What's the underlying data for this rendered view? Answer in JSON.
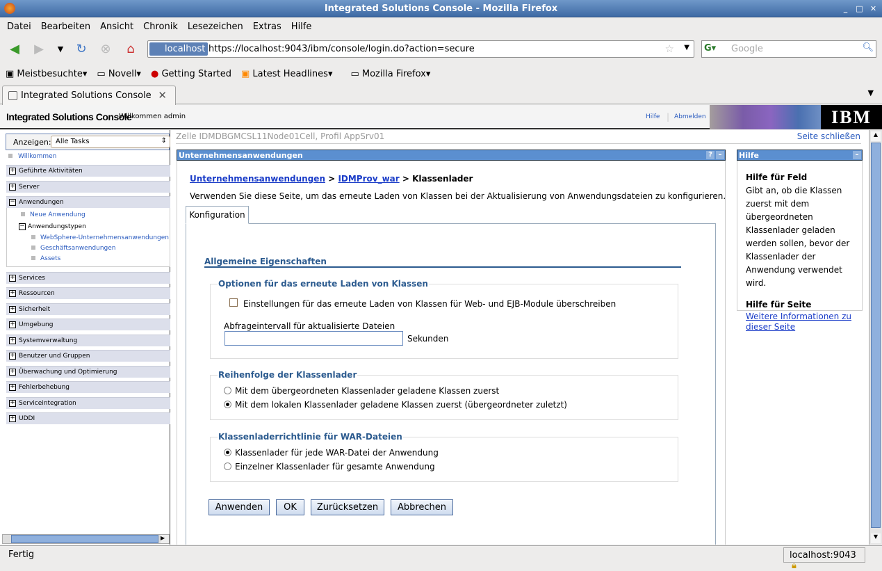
{
  "window": {
    "title": "Integrated Solutions Console - Mozilla Firefox"
  },
  "menu": [
    "Datei",
    "Bearbeiten",
    "Ansicht",
    "Chronik",
    "Lesezeichen",
    "Extras",
    "Hilfe"
  ],
  "nav": {
    "site": "localhost",
    "url": "https://localhost:9043/ibm/console/login.do?action=secure",
    "search_placeholder": "Google"
  },
  "bookmarks": [
    "Meistbesuchte",
    "Novell",
    "Getting Started",
    "Latest Headlines",
    "Mozilla Firefox"
  ],
  "tab": {
    "title": "Integrated Solutions Console"
  },
  "header": {
    "title": "Integrated Solutions Console",
    "welcome": "Willkommen admin",
    "help": "Hilfe",
    "logout": "Abmelden",
    "logo": "IBM"
  },
  "sidebar": {
    "show_label": "Anzeigen:",
    "show_value": "Alle Tasks",
    "welcome": "Willkommen",
    "sections": [
      "Geführte Aktivitäten",
      "Server",
      "Anwendungen",
      "Services",
      "Ressourcen",
      "Sicherheit",
      "Umgebung",
      "Systemverwaltung",
      "Benutzer und Gruppen",
      "Überwachung und Optimierung",
      "Fehlerbehebung",
      "Serviceintegration",
      "UDDI"
    ],
    "new_app": "Neue Anwendung",
    "app_types": "Anwendungstypen",
    "app_type_items": [
      "WebSphere-Unternehmensanwendungen",
      "Geschäftsanwendungen",
      "Assets"
    ]
  },
  "main": {
    "cell": "Zelle IDMDBGMCSL11Node01Cell, Profil AppSrv01",
    "close_page": "Seite schließen",
    "panel_title": "Unternehmensanwendungen",
    "breadcrumb": {
      "a": "Unternehmensanwendungen",
      "b": "IDMProv_war",
      "sep": ">",
      "current": "Klassenlader"
    },
    "description": "Verwenden Sie diese Seite, um das erneute Laden von Klassen bei der Aktualisierung von Anwendungsdateien zu konfigurieren.",
    "tab_config": "Konfiguration",
    "general": "Allgemeine Eigenschaften",
    "reload": {
      "legend": "Optionen für das erneute Laden von Klassen",
      "override": "Einstellungen für das erneute Laden von Klassen für Web- und EJB-Module überschreiben",
      "override_checked": false,
      "interval_label": "Abfrageintervall für aktualisierte Dateien",
      "interval_value": "",
      "unit": "Sekunden"
    },
    "order": {
      "legend": "Reihenfolge der Klassenlader",
      "options": [
        "Mit dem übergeordneten Klassenlader geladene Klassen zuerst",
        "Mit dem lokalen Klassenlader geladene Klassen zuerst (übergeordneter zuletzt)"
      ],
      "selected": 1
    },
    "war": {
      "legend": "Klassenladerrichtlinie für WAR-Dateien",
      "options": [
        "Klassenlader für jede WAR-Datei der Anwendung",
        "Einzelner Klassenlader für gesamte Anwendung"
      ],
      "selected": 0
    },
    "buttons": {
      "apply": "Anwenden",
      "ok": "OK",
      "reset": "Zurücksetzen",
      "cancel": "Abbrechen"
    }
  },
  "help": {
    "title": "Hilfe",
    "field_title": "Hilfe für Feld",
    "field_text": "Gibt an, ob die Klassen zuerst mit dem übergeordneten Klassenlader geladen werden sollen, bevor der Klassenlader der Anwendung verwendet wird.",
    "page_title": "Hilfe für Seite",
    "page_link": "Weitere Informationen zu dieser Seite"
  },
  "status": {
    "text": "Fertig",
    "host": "localhost:9043"
  }
}
